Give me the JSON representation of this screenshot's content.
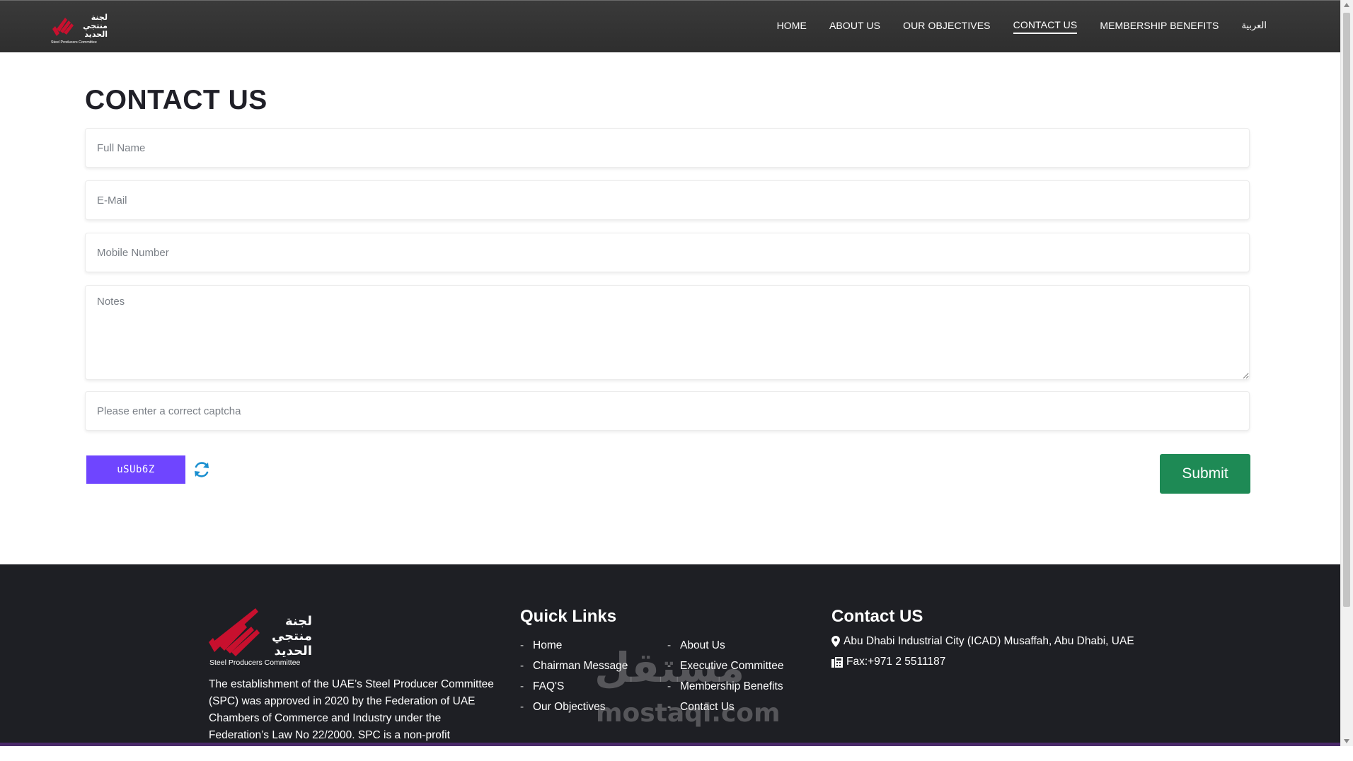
{
  "header": {
    "logo_ar_line1": "لجنة",
    "logo_ar_line2": "منتجي",
    "logo_ar_line3": "الحديد",
    "logo_en": "Steel Producers Committee",
    "nav": [
      {
        "label": "HOME"
      },
      {
        "label": "ABOUT US"
      },
      {
        "label": "OUR OBJECTIVES"
      },
      {
        "label": "CONTACT US",
        "active": true
      },
      {
        "label": "MEMBERSHIP BENEFITS"
      },
      {
        "label": "العربية"
      }
    ]
  },
  "main": {
    "title": "CONTACT US",
    "form": {
      "full_name_placeholder": "Full Name",
      "email_placeholder": "E-Mail",
      "mobile_placeholder": "Mobile Number",
      "notes_placeholder": "Notes",
      "captcha_placeholder": "Please enter a correct captcha",
      "captcha_code": "uSUb6Z",
      "submit_label": "Submit"
    }
  },
  "footer": {
    "logo_ar_line1": "لجنة",
    "logo_ar_line2": "منتجي",
    "logo_ar_line3": "الحديد",
    "logo_en": "Steel Producers Committee",
    "about_text": "The establishment of the UAE’s Steel Producer Committee (SPC) was approved in 2020 by the Federation of UAE Chambers of Commerce and Industry under the Federation’s Law No 22/2000. SPC is a non-profit committee that",
    "quick_links_title": "Quick Links",
    "links_col1": [
      "Home",
      "Chairman Message",
      "FAQ'S",
      "Our Objectives"
    ],
    "links_col2": [
      "About Us",
      "Executive Committee",
      "Membership Benefits",
      "Contact Us"
    ],
    "contact_title": "Contact US",
    "address": "Abu Dhabi Industrial City (ICAD) Musaffah, Abu Dhabi, UAE",
    "fax": "Fax:+971 2 5511187"
  },
  "watermark": {
    "arabic": "مستقل",
    "latin": "mostaql.com"
  },
  "icons": {
    "location": "map-marker-icon",
    "fax": "fax-icon",
    "refresh": "refresh-icon"
  },
  "colors": {
    "header_bg": "#333333",
    "footer_bg": "#1e1f24",
    "submit_bg": "#1e8a55",
    "captcha_bg": "#6f45ff",
    "refresh_icon": "#1a8fd0",
    "logo_red": "#c8102e"
  }
}
